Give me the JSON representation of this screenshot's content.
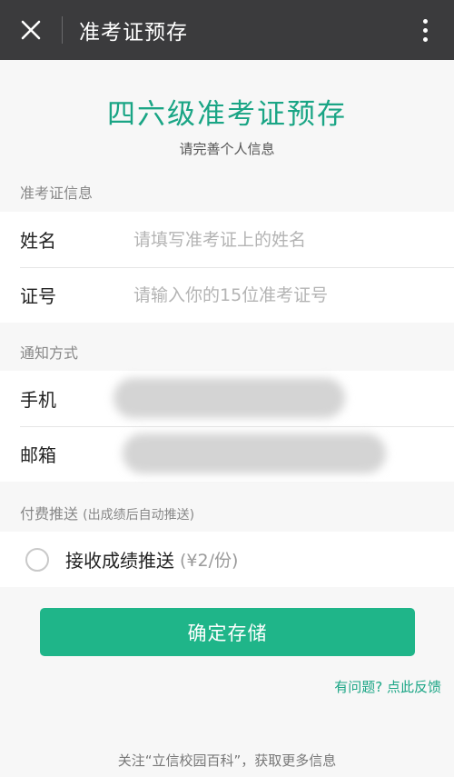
{
  "topbar": {
    "title": "准考证预存"
  },
  "hero": {
    "title": "四六级准考证预存",
    "subtitle": "请完善个人信息"
  },
  "sections": {
    "ticket_info": "准考证信息",
    "notify": "通知方式",
    "paid_push": "付费推送",
    "paid_push_note": "(出成绩后自动推送)"
  },
  "fields": {
    "name": {
      "label": "姓名",
      "placeholder": "请填写准考证上的姓名",
      "value": ""
    },
    "id": {
      "label": "证号",
      "placeholder": "请输入你的15位准考证号",
      "value": ""
    },
    "phone": {
      "label": "手机"
    },
    "email": {
      "label": "邮箱"
    }
  },
  "push_option": {
    "label": "接收成绩推送",
    "price": "(¥2/份)",
    "checked": false
  },
  "submit_label": "确定存储",
  "feedback_link": "有问题? 点此反馈",
  "footer_text": "关注“立信校园百科”，获取更多信息"
}
